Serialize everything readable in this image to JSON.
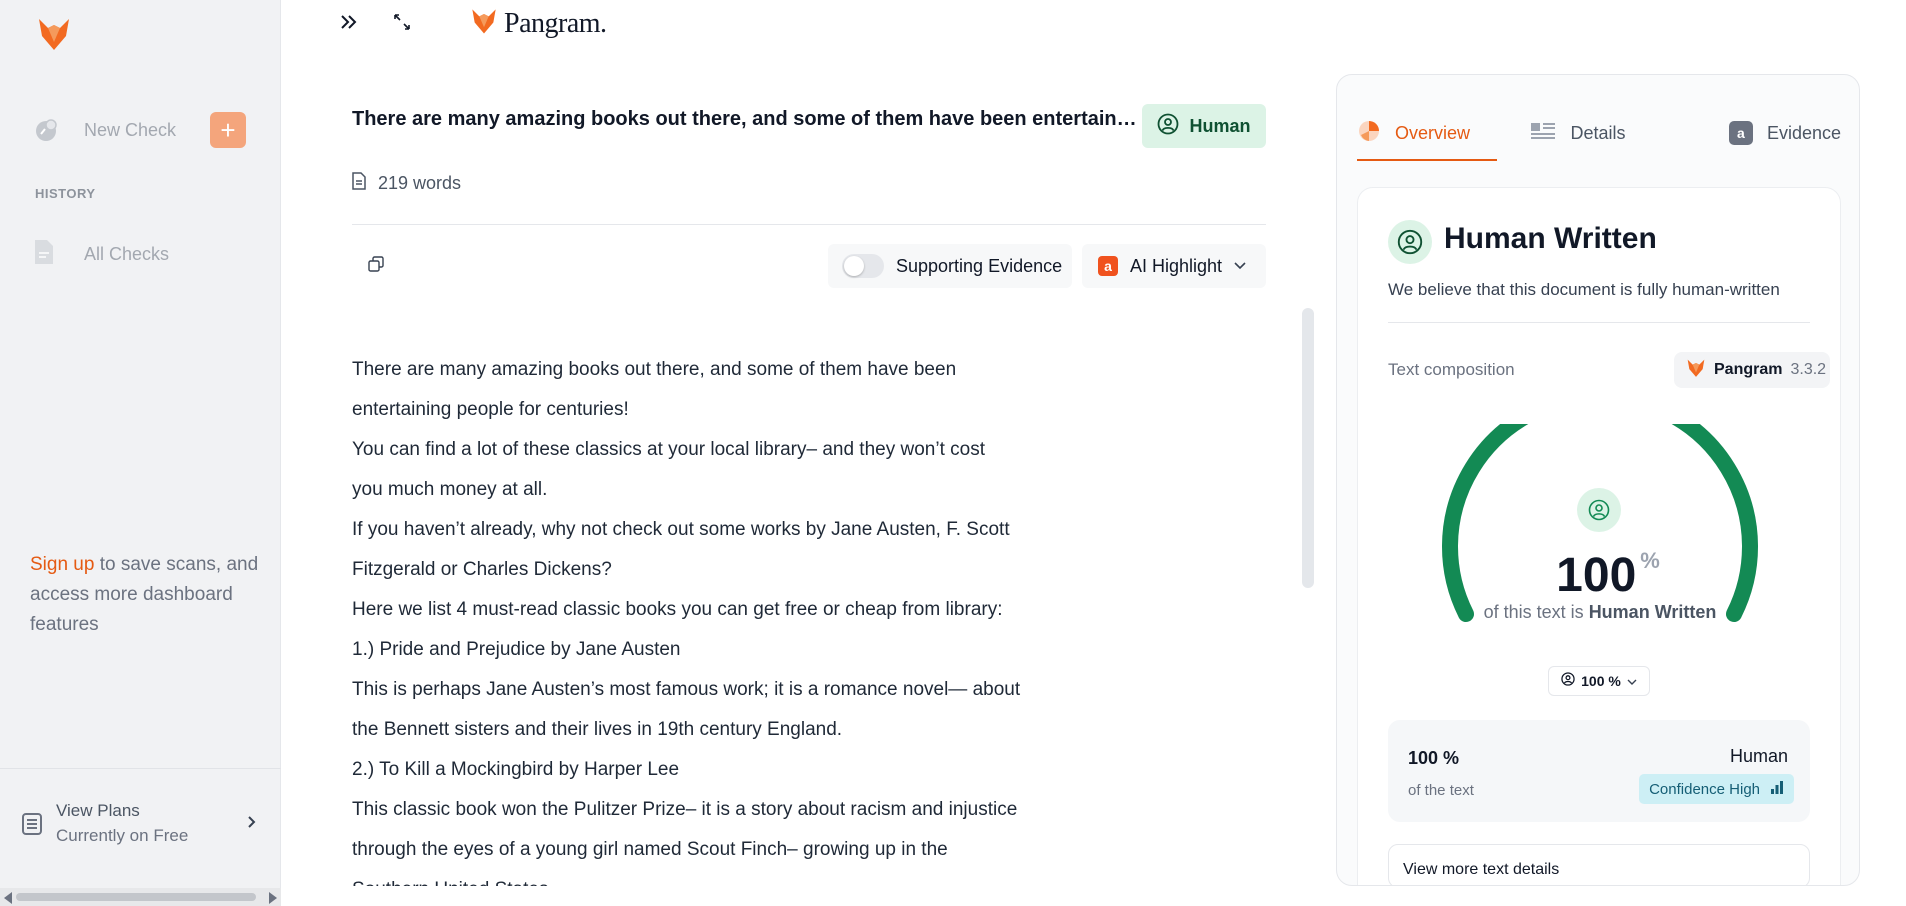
{
  "sidebar": {
    "new_check_label": "New Check",
    "plus_label": "+",
    "history_label": "HISTORY",
    "all_checks_label": "All Checks",
    "signup_link": "Sign up",
    "signup_rest": " to save scans, and access more dashboard features",
    "view_plans_title": "View Plans",
    "view_plans_sub": "Currently on Free"
  },
  "topbar": {
    "brand_name": "Pangram."
  },
  "document": {
    "title": "There are many amazing books out there, and some of them have been entertaining people for centuries!",
    "verdict_badge": "Human",
    "word_count": "219 words",
    "supporting_evidence_label": "Supporting Evidence",
    "ai_badge_letter": "a",
    "ai_highlight_label": "AI Highlight",
    "lines": [
      "There are many amazing books out there, and some of them have been",
      "entertaining people for centuries!",
      "You can find a lot of these classics at your local library– and they won’t cost",
      "you much money at all.",
      "If you haven’t already, why not check out some works by Jane Austen, F. Scott",
      "Fitzgerald or Charles Dickens?",
      "Here we list 4 must-read classic books you can get free or cheap from library:",
      "1.) Pride and Prejudice by Jane Austen",
      "This is perhaps Jane Austen’s most famous work; it is a romance novel— about",
      "the Bennett sisters and their lives in 19th century England.",
      "2.) To Kill a Mockingbird by Harper Lee",
      "This classic book won the Pulitzer Prize– it is a story about racism and injustice",
      "through the eyes of a young girl named Scout Finch– growing up in the",
      "Southern United States."
    ]
  },
  "panel": {
    "tabs": [
      {
        "label": "Overview",
        "active": true
      },
      {
        "label": "Details",
        "active": false
      },
      {
        "label": "Evidence",
        "active": false
      }
    ],
    "evidence_badge_letter": "a",
    "result_title": "Human Written",
    "result_desc": "We believe that this document is fully human-written",
    "text_composition_label": "Text composition",
    "model_name": "Pangram",
    "model_version": "3.3.2",
    "gauge_value": "100",
    "gauge_fraction": 1.0,
    "gauge_unit": "%",
    "gauge_caption_prefix": "of this text is ",
    "gauge_caption_bold": "Human Written",
    "pct_select_value": "100 %",
    "summary_pct": "100 %",
    "summary_sub": "of the text",
    "summary_class": "Human",
    "confidence_label": "Confidence High",
    "more_details_label": "View more text details"
  },
  "colors": {
    "brand_orange": "#e55a12",
    "human_green": "#138a54",
    "human_bg": "#dcf3e6"
  }
}
